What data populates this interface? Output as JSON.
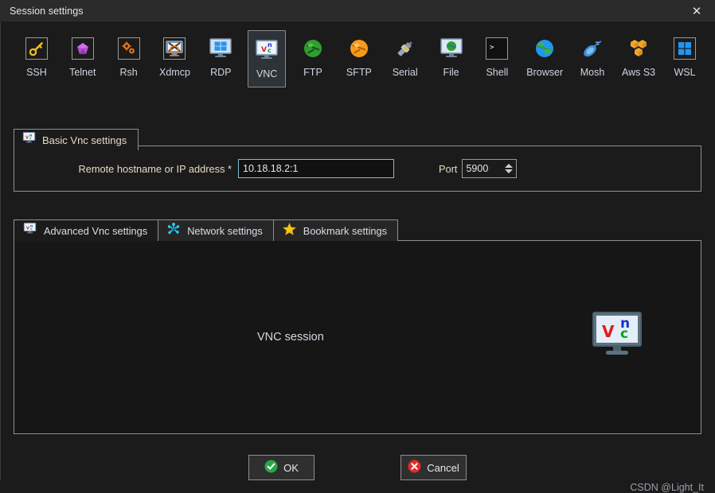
{
  "titlebar": {
    "title": "Session settings",
    "close_label": "✕",
    "close_icon": "close-icon"
  },
  "toolbar": {
    "protocols": [
      {
        "label": "SSH",
        "icon": "key-icon",
        "selected": false
      },
      {
        "label": "Telnet",
        "icon": "gem-icon",
        "selected": false
      },
      {
        "label": "Rsh",
        "icon": "gears-icon",
        "selected": false
      },
      {
        "label": "Xdmcp",
        "icon": "x-monitor-icon",
        "selected": false
      },
      {
        "label": "RDP",
        "icon": "windows-monitor-icon",
        "selected": false
      },
      {
        "label": "VNC",
        "icon": "vnc-monitor-icon",
        "selected": true
      },
      {
        "label": "FTP",
        "icon": "green-globe-icon",
        "selected": false
      },
      {
        "label": "SFTP",
        "icon": "orange-globe-icon",
        "selected": false
      },
      {
        "label": "Serial",
        "icon": "serial-plug-icon",
        "selected": false
      },
      {
        "label": "File",
        "icon": "file-monitor-icon",
        "selected": false
      },
      {
        "label": "Shell",
        "icon": "terminal-icon",
        "selected": false
      },
      {
        "label": "Browser",
        "icon": "blue-globe-icon",
        "selected": false
      },
      {
        "label": "Mosh",
        "icon": "satellite-icon",
        "selected": false
      },
      {
        "label": "Aws S3",
        "icon": "aws-cubes-icon",
        "selected": false
      },
      {
        "label": "WSL",
        "icon": "windows-logo-icon",
        "selected": false
      }
    ]
  },
  "basic_settings": {
    "group_title": "Basic Vnc settings",
    "group_icon": "vnc-monitor-icon",
    "host_label": "Remote hostname or IP address *",
    "host_value": "10.18.18.2:1",
    "host_placeholder": "",
    "port_label": "Port",
    "port_value": "5900",
    "spinner_up_icon": "chevron-up-icon",
    "spinner_down_icon": "chevron-down-icon"
  },
  "tabs": [
    {
      "label": "Advanced Vnc settings",
      "icon": "vnc-monitor-icon",
      "active": true
    },
    {
      "label": "Network settings",
      "icon": "network-star-icon",
      "active": false
    },
    {
      "label": "Bookmark settings",
      "icon": "star-icon",
      "active": false
    }
  ],
  "tab_panel": {
    "session_caption": "VNC session",
    "logo_icon": "vnc-monitor-logo",
    "logo_letters": {
      "v": "V",
      "n": "n",
      "c": "c"
    }
  },
  "buttons": {
    "ok": {
      "label": "OK",
      "icon": "check-circle-icon",
      "color": "#2aa745"
    },
    "cancel": {
      "label": "Cancel",
      "icon": "x-circle-icon",
      "color": "#e02b2b"
    }
  },
  "watermark": "CSDN @Light_It",
  "colors": {
    "window_bg": "#1b1b1b",
    "titlebar_bg": "#2b2b2b",
    "border": "#8f8f8f",
    "label_text": "#e8d9c4",
    "focus_border": "#79c3d4"
  }
}
